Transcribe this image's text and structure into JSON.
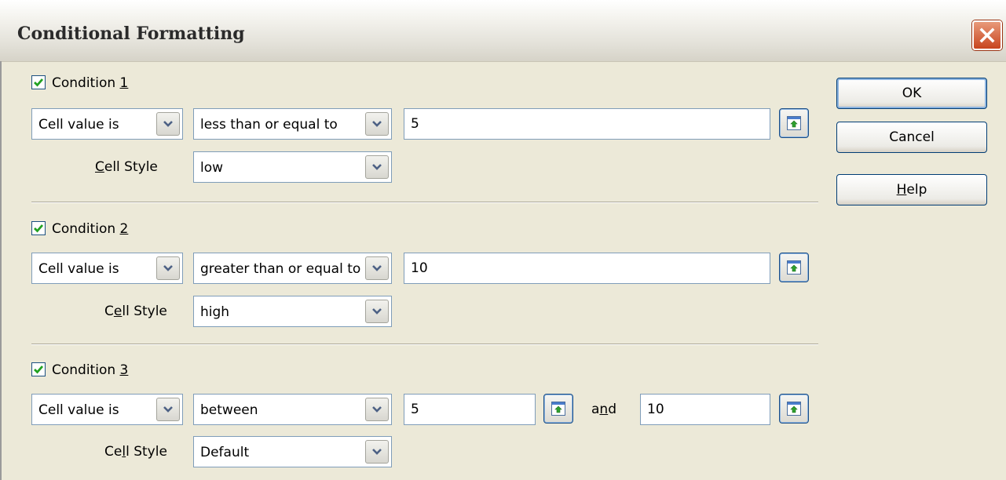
{
  "dialog": {
    "title": "Conditional Formatting"
  },
  "conditions": [
    {
      "label_pre": "Condition ",
      "label_key": "1",
      "label_post": "",
      "checked": true,
      "type_value": "Cell value is",
      "operator_value": "less than or equal to",
      "value1": "5",
      "and_pre": "",
      "and_key": "",
      "and_post": "",
      "value2": "",
      "style_label_pre": "",
      "style_label_key": "C",
      "style_label_post": "ell Style",
      "style_value": "low"
    },
    {
      "label_pre": "Condition ",
      "label_key": "2",
      "label_post": "",
      "checked": true,
      "type_value": "Cell value is",
      "operator_value": "greater than or equal to",
      "value1": "10",
      "and_pre": "",
      "and_key": "",
      "and_post": "",
      "value2": "",
      "style_label_pre": "C",
      "style_label_key": "e",
      "style_label_post": "ll Style",
      "style_value": "high"
    },
    {
      "label_pre": "Condition ",
      "label_key": "3",
      "label_post": "",
      "checked": true,
      "type_value": "Cell value is",
      "operator_value": "between",
      "value1": "5",
      "and_pre": "a",
      "and_key": "n",
      "and_post": "d",
      "value2": "10",
      "style_label_pre": "Ce",
      "style_label_key": "l",
      "style_label_post": "l Style",
      "style_value": "Default"
    }
  ],
  "buttons": {
    "ok": "OK",
    "cancel": "Cancel",
    "help_key": "H",
    "help_rest": "elp"
  },
  "colors": {
    "dialog_bg": "#ece9d8",
    "close_red": "#c8441e",
    "check_green": "#21a121",
    "button_border": "#003c74"
  },
  "icons": {
    "close": "close-icon",
    "dropdown": "chevron-down-icon",
    "shrink": "shrink-icon",
    "checkbox": "check-icon"
  }
}
